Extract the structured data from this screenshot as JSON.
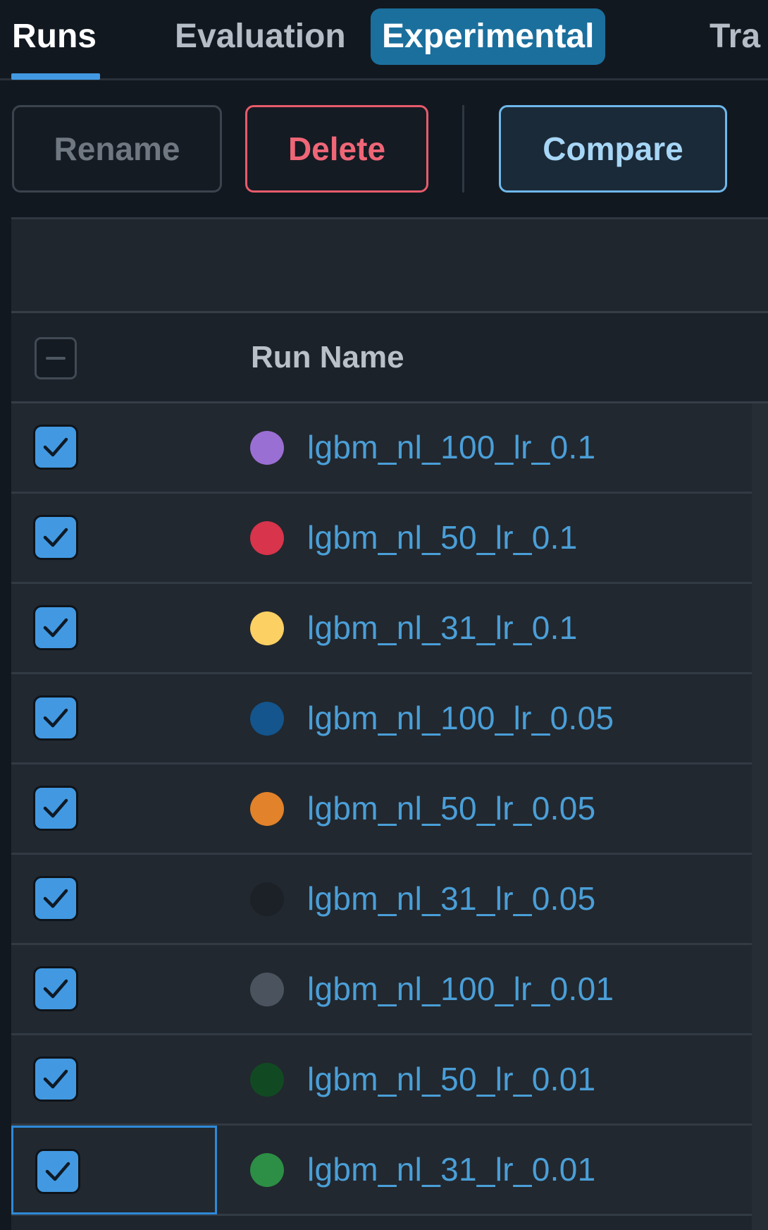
{
  "tabs": [
    {
      "label": "Runs",
      "active": true
    },
    {
      "label": "Evaluation"
    },
    {
      "label": "Experimental",
      "badge": true
    },
    {
      "label": "Tra"
    }
  ],
  "toolbar": {
    "rename_label": "Rename",
    "delete_label": "Delete",
    "compare_label": "Compare"
  },
  "table": {
    "column_run_name": "Run Name",
    "rows": [
      {
        "name": "lgbm_nl_100_lr_0.1",
        "color": "#9a6fd4",
        "checked": true
      },
      {
        "name": "lgbm_nl_50_lr_0.1",
        "color": "#d8344c",
        "checked": true
      },
      {
        "name": "lgbm_nl_31_lr_0.1",
        "color": "#fcd063",
        "checked": true
      },
      {
        "name": "lgbm_nl_100_lr_0.05",
        "color": "#13558c",
        "checked": true
      },
      {
        "name": "lgbm_nl_50_lr_0.05",
        "color": "#e2822a",
        "checked": true
      },
      {
        "name": "lgbm_nl_31_lr_0.05",
        "color": "#1c2127",
        "checked": true
      },
      {
        "name": "lgbm_nl_100_lr_0.01",
        "color": "#4b545e",
        "checked": true
      },
      {
        "name": "lgbm_nl_50_lr_0.01",
        "color": "#114a22",
        "checked": true
      },
      {
        "name": "lgbm_nl_31_lr_0.01",
        "color": "#2c8f45",
        "checked": true,
        "focused": true
      }
    ]
  },
  "colors": {
    "accent": "#4299e1",
    "tab_badge": "#1b6f9d",
    "delete": "#ef6677",
    "link": "#4a9fd8"
  }
}
